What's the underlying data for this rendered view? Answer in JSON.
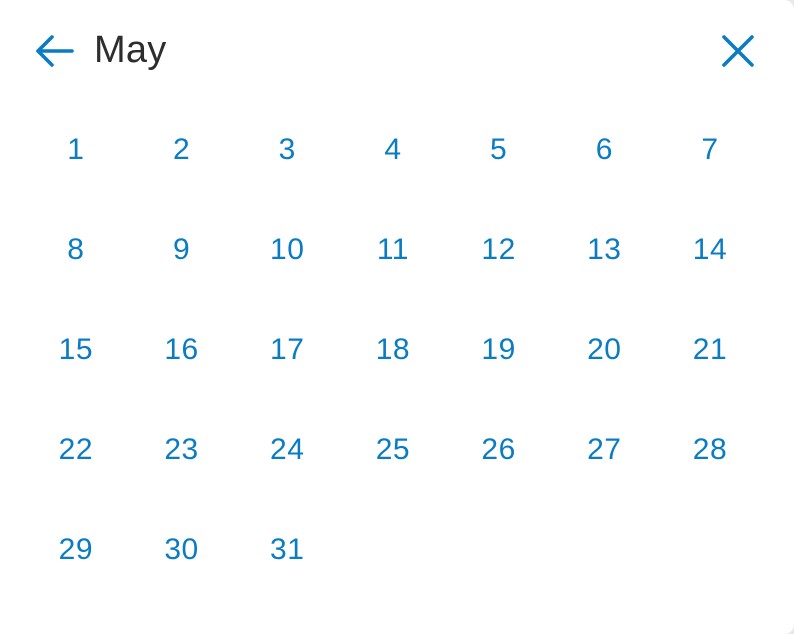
{
  "header": {
    "month": "May",
    "back_icon": "arrow-left-icon",
    "close_icon": "close-icon"
  },
  "colors": {
    "accent": "#0a7cc4",
    "title": "#2d2d2d",
    "background": "#ffffff"
  },
  "days": [
    "1",
    "2",
    "3",
    "4",
    "5",
    "6",
    "7",
    "8",
    "9",
    "10",
    "11",
    "12",
    "13",
    "14",
    "15",
    "16",
    "17",
    "18",
    "19",
    "20",
    "21",
    "22",
    "23",
    "24",
    "25",
    "26",
    "27",
    "28",
    "29",
    "30",
    "31"
  ]
}
